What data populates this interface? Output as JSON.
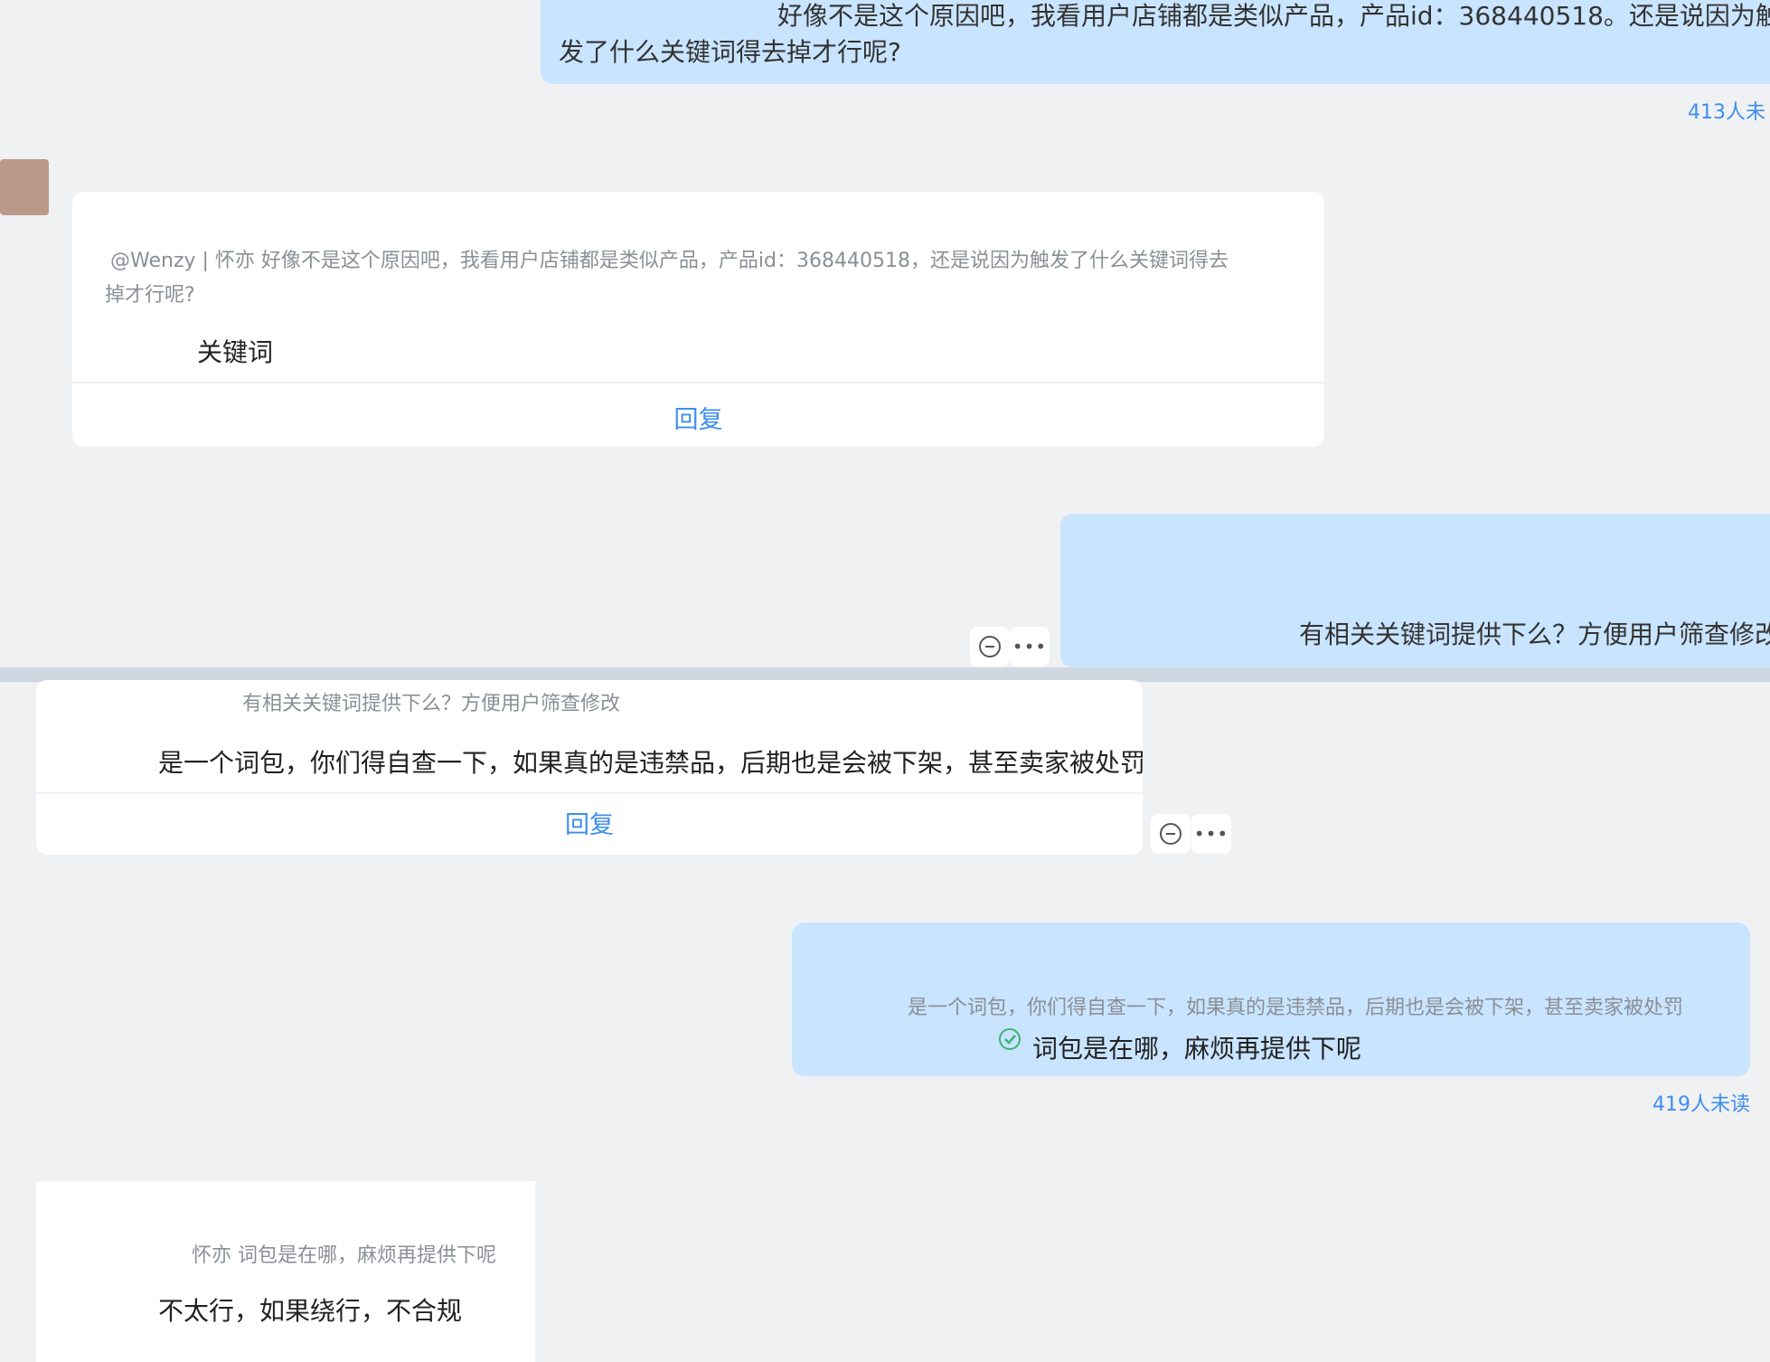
{
  "messages": {
    "m1": {
      "text_line1": "好像不是这个原因吧，我看用户店铺都是类似产品，产品id：368440518。还是说因为触",
      "text_line2": "发了什么关键词得去掉才行呢?",
      "read_count": "413人未"
    },
    "m2": {
      "quote_line1": "@Wenzy | 怀亦 好像不是这个原因吧，我看用户店铺都是类似产品，产品id：368440518，还是说因为触发了什么关键词得去",
      "quote_line2": "掉才行呢?",
      "text": "关键词",
      "reply_label": "回复"
    },
    "m3": {
      "text": "有相关关键词提供下么？方便用户筛查修改"
    },
    "m4": {
      "quote": "有相关关键词提供下么？方便用户筛查修改",
      "text": "是一个词包，你们得自查一下，如果真的是违禁品，后期也是会被下架，甚至卖家被处罚",
      "reply_label": "回复"
    },
    "m5": {
      "quote": "是一个词包，你们得自查一下，如果真的是违禁品，后期也是会被下架，甚至卖家被处罚",
      "text": "词包是在哪，麻烦再提供下呢",
      "read_count": "419人未读"
    },
    "m6": {
      "quote": "怀亦 词包是在哪，麻烦再提供下呢",
      "text": "不太行，如果绕行，不合规"
    }
  },
  "colors": {
    "outgoing_bubble": "#c9e4ff",
    "link_blue": "#3d8ef0",
    "read_check_green": "#3cb371"
  },
  "icons": [
    "comment-icon",
    "more-icon",
    "read-check-icon"
  ]
}
